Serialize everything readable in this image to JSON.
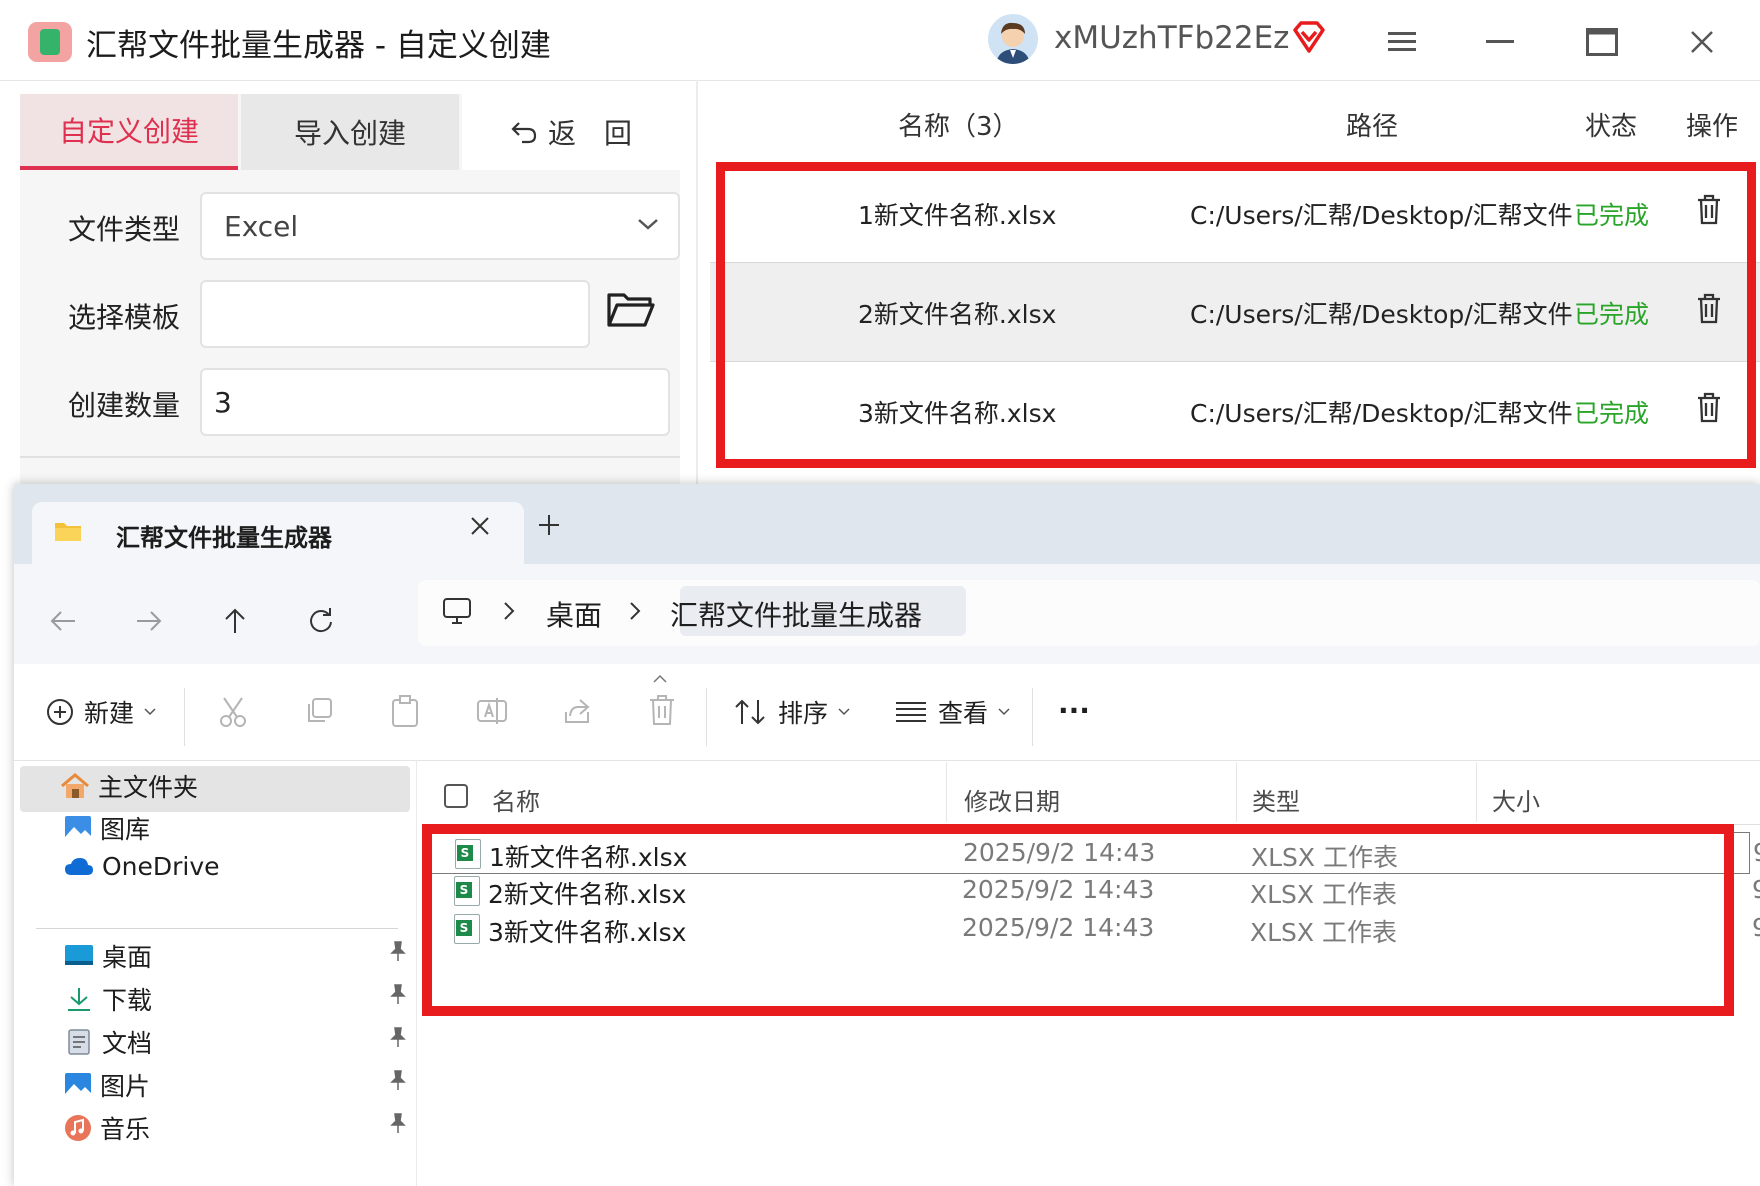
{
  "app": {
    "title": "汇帮文件批量生成器 - 自定义创建",
    "username": "xMUzhTFb22Ez",
    "tabs": {
      "custom": "自定义创建",
      "import": "导入创建",
      "back": "返　回"
    },
    "form": {
      "file_type_label": "文件类型",
      "file_type_value": "Excel",
      "template_label": "选择模板",
      "template_value": "",
      "count_label": "创建数量",
      "count_value": "3"
    },
    "table": {
      "headers": {
        "name": "名称（3）",
        "path": "路径",
        "status": "状态",
        "action": "操作"
      },
      "rows": [
        {
          "name": "1新文件名称.xlsx",
          "path": "C:/Users/汇帮/Desktop/汇帮文件",
          "status": "已完成"
        },
        {
          "name": "2新文件名称.xlsx",
          "path": "C:/Users/汇帮/Desktop/汇帮文件",
          "status": "已完成"
        },
        {
          "name": "3新文件名称.xlsx",
          "path": "C:/Users/汇帮/Desktop/汇帮文件",
          "status": "已完成"
        }
      ]
    }
  },
  "explorer": {
    "tab_title": "汇帮文件批量生成器",
    "breadcrumb": [
      "桌面",
      "汇帮文件批量生成器"
    ],
    "toolbar": {
      "new": "新建",
      "sort": "排序",
      "view": "查看",
      "more": "···"
    },
    "sidebar": {
      "top": [
        "主文件夹",
        "图库",
        "OneDrive"
      ],
      "pinned": [
        "桌面",
        "下载",
        "文档",
        "图片",
        "音乐"
      ]
    },
    "list": {
      "headers": {
        "name": "名称",
        "date": "修改日期",
        "type": "类型",
        "size": "大小"
      },
      "rows": [
        {
          "name": "1新文件名称.xlsx",
          "date": "2025/9/2 14:43",
          "type": "XLSX 工作表",
          "size": "9"
        },
        {
          "name": "2新文件名称.xlsx",
          "date": "2025/9/2 14:43",
          "type": "XLSX 工作表",
          "size": "9"
        },
        {
          "name": "3新文件名称.xlsx",
          "date": "2025/9/2 14:43",
          "type": "XLSX 工作表",
          "size": "9"
        }
      ]
    }
  },
  "colors": {
    "accent": "#e0304f",
    "status_done": "#2aa52a",
    "highlight_box": "#e81c1c"
  }
}
